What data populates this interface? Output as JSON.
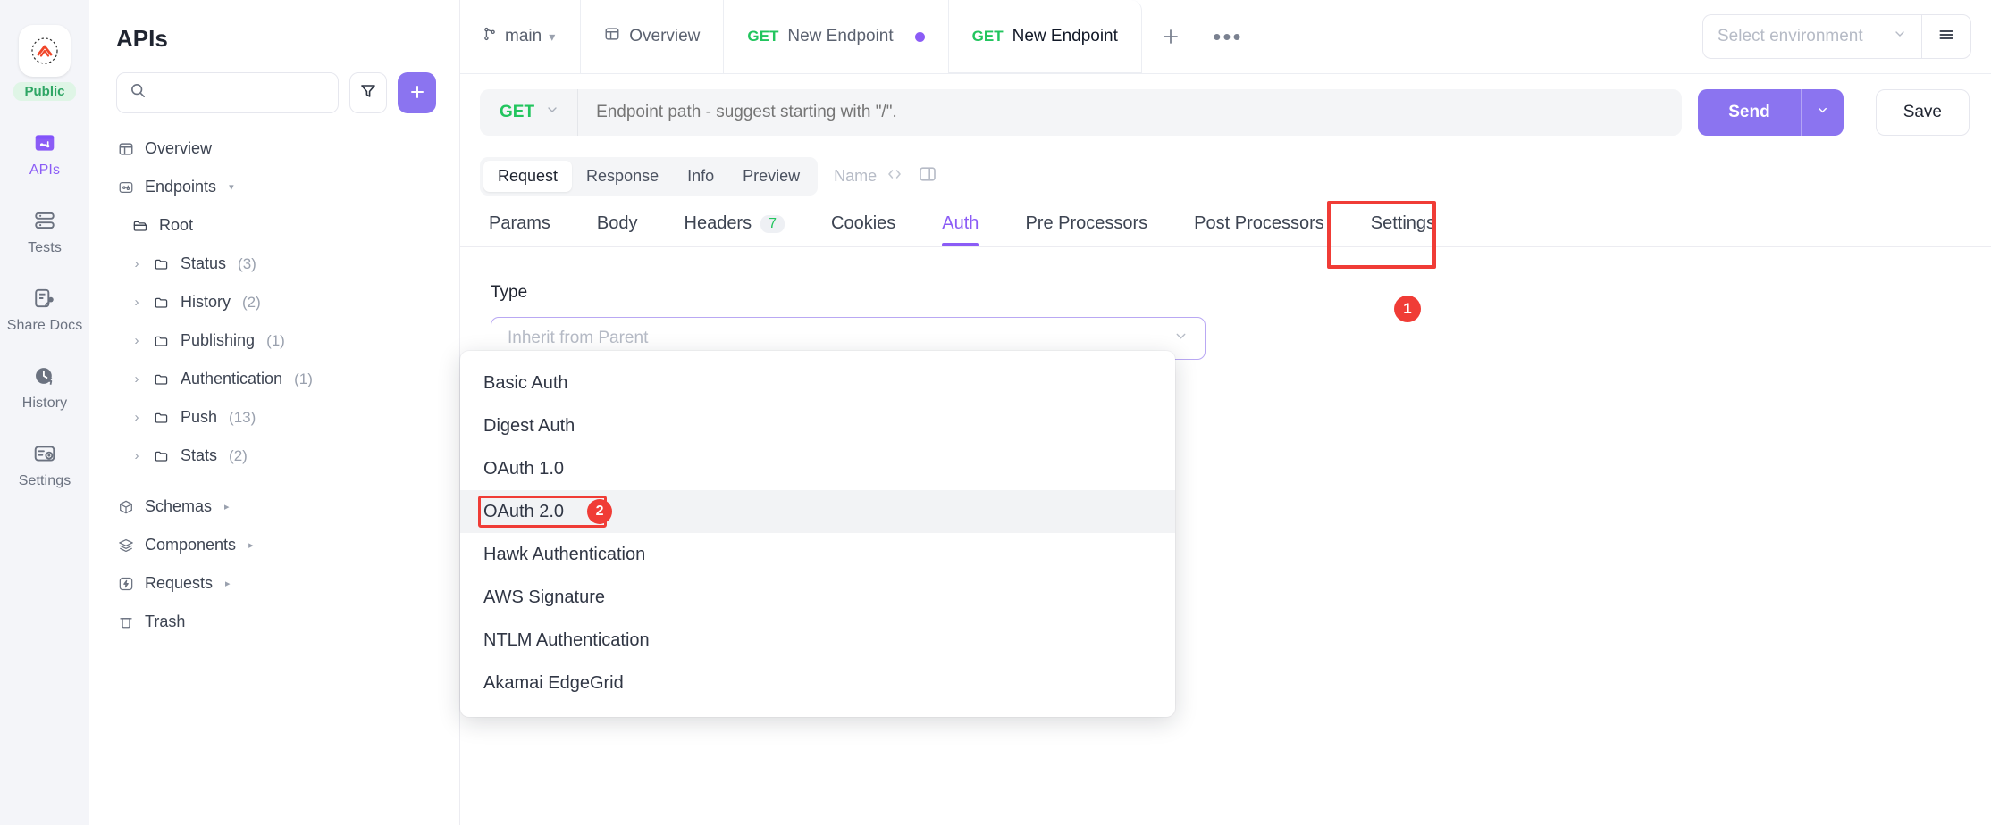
{
  "rail": {
    "workspace_badge": "Public",
    "items": [
      {
        "label": "APIs",
        "icon": "api-icon",
        "active": true
      },
      {
        "label": "Tests",
        "icon": "tests-icon",
        "active": false
      },
      {
        "label": "Share Docs",
        "icon": "share-docs-icon",
        "active": false
      },
      {
        "label": "History",
        "icon": "history-icon",
        "active": false
      },
      {
        "label": "Settings",
        "icon": "settings-icon",
        "active": false
      }
    ]
  },
  "sidebar": {
    "title": "APIs",
    "search_placeholder": "",
    "search_value": "",
    "filter_icon": "filter-icon",
    "add_label": "+",
    "tree": [
      {
        "label": "Overview",
        "icon": "overview-icon",
        "indent": 0,
        "caret": "",
        "count": "",
        "arrow": ""
      },
      {
        "label": "Endpoints",
        "icon": "endpoints-icon",
        "indent": 0,
        "caret": "",
        "count": "",
        "arrow": "▾"
      },
      {
        "label": "Root",
        "icon": "folder-open-icon",
        "indent": 1,
        "caret": "",
        "count": "",
        "arrow": ""
      },
      {
        "label": "Status",
        "icon": "folder-icon",
        "indent": 2,
        "caret": "›",
        "count": "(3)",
        "arrow": ""
      },
      {
        "label": "History",
        "icon": "folder-icon",
        "indent": 2,
        "caret": "›",
        "count": "(2)",
        "arrow": ""
      },
      {
        "label": "Publishing",
        "icon": "folder-icon",
        "indent": 2,
        "caret": "›",
        "count": "(1)",
        "arrow": ""
      },
      {
        "label": "Authentication",
        "icon": "folder-icon",
        "indent": 2,
        "caret": "›",
        "count": "(1)",
        "arrow": ""
      },
      {
        "label": "Push",
        "icon": "folder-icon",
        "indent": 2,
        "caret": "›",
        "count": "(13)",
        "arrow": ""
      },
      {
        "label": "Stats",
        "icon": "folder-icon",
        "indent": 2,
        "caret": "›",
        "count": "(2)",
        "arrow": ""
      },
      {
        "label": "Schemas",
        "icon": "schemas-icon",
        "indent": 0,
        "caret": "",
        "count": "",
        "arrow": "▸"
      },
      {
        "label": "Components",
        "icon": "components-icon",
        "indent": 0,
        "caret": "",
        "count": "",
        "arrow": "▸"
      },
      {
        "label": "Requests",
        "icon": "requests-icon",
        "indent": 0,
        "caret": "",
        "count": "",
        "arrow": "▸"
      },
      {
        "label": "Trash",
        "icon": "trash-icon",
        "indent": 0,
        "caret": "",
        "count": "",
        "arrow": ""
      }
    ]
  },
  "topbar": {
    "branch": "main",
    "tabs": [
      {
        "verb": "",
        "label": "Overview",
        "icon": "overview-icon",
        "dot": false,
        "active": false
      },
      {
        "verb": "GET",
        "label": "New Endpoint",
        "icon": "",
        "dot": true,
        "active": false
      },
      {
        "verb": "GET",
        "label": "New Endpoint",
        "icon": "",
        "dot": false,
        "active": true
      }
    ],
    "new_tab_label": "+",
    "more_label": "•••",
    "environment_placeholder": "Select environment",
    "environment_menu_icon": "hamburger-icon"
  },
  "urlbar": {
    "method": "GET",
    "path_value": "",
    "path_placeholder": "Endpoint path - suggest starting with \"/\".",
    "send_label": "Send",
    "send_caret_icon": "chevron-down-icon",
    "save_label": "Save"
  },
  "view_tabs": {
    "items": [
      "Request",
      "Response",
      "Info",
      "Preview"
    ],
    "active": "Request",
    "name_placeholder": "Name",
    "code_icon": "code-icon",
    "panel_icon": "split-panel-icon",
    "step_badge": "1"
  },
  "request_tabs": {
    "items": [
      {
        "label": "Params",
        "badge": ""
      },
      {
        "label": "Body",
        "badge": ""
      },
      {
        "label": "Headers",
        "badge": "7"
      },
      {
        "label": "Cookies",
        "badge": ""
      },
      {
        "label": "Auth",
        "badge": ""
      },
      {
        "label": "Pre Processors",
        "badge": ""
      },
      {
        "label": "Post Processors",
        "badge": ""
      },
      {
        "label": "Settings",
        "badge": ""
      }
    ],
    "active": "Auth"
  },
  "auth_panel": {
    "type_label": "Type",
    "type_placeholder": "Inherit from Parent",
    "type_value": "",
    "dropdown_open": true,
    "options": [
      {
        "label": "Basic Auth",
        "hover": false,
        "highlight": false,
        "badge": ""
      },
      {
        "label": "Digest Auth",
        "hover": false,
        "highlight": false,
        "badge": ""
      },
      {
        "label": "OAuth 1.0",
        "hover": false,
        "highlight": false,
        "badge": ""
      },
      {
        "label": "OAuth 2.0",
        "hover": true,
        "highlight": true,
        "badge": "2"
      },
      {
        "label": "Hawk Authentication",
        "hover": false,
        "highlight": false,
        "badge": ""
      },
      {
        "label": "AWS Signature",
        "hover": false,
        "highlight": false,
        "badge": ""
      },
      {
        "label": "NTLM Authentication",
        "hover": false,
        "highlight": false,
        "badge": ""
      },
      {
        "label": "Akamai EdgeGrid",
        "hover": false,
        "highlight": false,
        "badge": ""
      }
    ]
  },
  "colors": {
    "accent": "#8b5cf6",
    "accent_button": "#8b74f0",
    "method_get": "#22c55e",
    "annotation_red": "#f03c36",
    "public_badge_bg": "#dff5e6",
    "public_badge_text": "#2fa665"
  }
}
